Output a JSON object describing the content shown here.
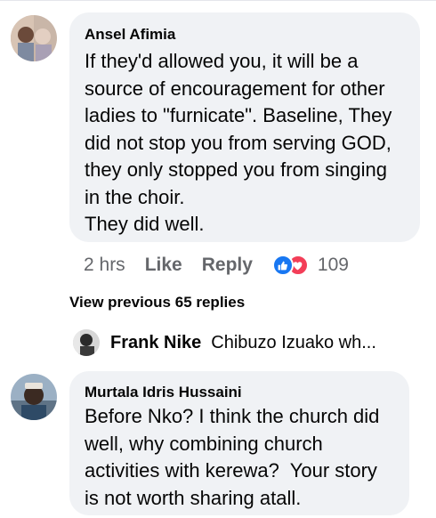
{
  "comments": [
    {
      "author": "Ansel Afimia",
      "text": "If they'd allowed you, it will be a\nsource of encouragement for other\nladies to \"furnicate\". Baseline, They\ndid not stop you from serving GOD,\nthey only stopped you from singing\nin the choir.\nThey did well.",
      "time": "2 hrs",
      "like_label": "Like",
      "reply_label": "Reply",
      "reaction_count": "109",
      "reaction_icons": [
        "like-reaction-icon",
        "love-reaction-icon"
      ]
    },
    {
      "author": "Murtala Idris Hussaini",
      "text": "Before Nko? I think the church did\nwell, why combining church\nactivities with kerewa?  Your story\nis not worth sharing atall."
    }
  ],
  "view_previous_label": "View previous 65 replies",
  "collapsed_reply": {
    "author": "Frank Nike",
    "snippet": "Chibuzo Izuako wh..."
  },
  "colors": {
    "bubble": "#f0f2f5",
    "meta": "#65676b",
    "like_blue": "#1877f2",
    "love_red": "#f33e58"
  }
}
